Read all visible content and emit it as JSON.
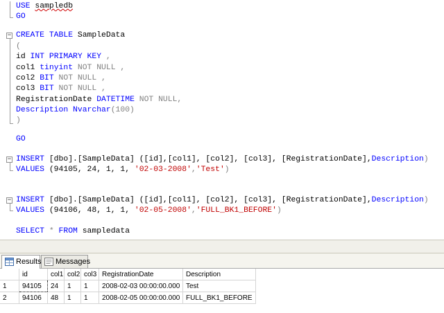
{
  "editor": {
    "lines": {
      "use_kw": "USE",
      "use_db": "sampledb",
      "go1": "GO",
      "create_kw": "CREATE TABLE",
      "create_name": " SampleData",
      "paren_open": "(",
      "id_name": "id ",
      "id_type": "INT PRIMARY KEY",
      "id_end": " ,",
      "c1_name": "col1 ",
      "c1_type": "tinyint",
      "c1_rest": " NOT NULL ,",
      "c2_name": "col2 ",
      "c2_type": "BIT",
      "c2_rest": " NOT NULL ,",
      "c3_name": "col3 ",
      "c3_type": "BIT",
      "c3_rest": " NOT NULL ,",
      "rd_name": "RegistrationDate ",
      "rd_type": "DATETIME",
      "rd_rest": " NOT NULL,",
      "de_name": "Description ",
      "de_type": "Nvarchar",
      "de_rest": "(100)",
      "paren_close": ")",
      "go2": "GO",
      "ins1_kw": "INSERT",
      "ins1_rest": " [dbo].[SampleData] ([id],[col1], [col2], [col3], [RegistrationDate],",
      "ins1_desc": "Description",
      "ins1_close": ")",
      "val1_kw": "VALUES",
      "val1_nums": " (94105, 24, 1, 1, ",
      "val1_date": "'02-03-2008'",
      "val1_comma": ",",
      "val1_str": "'Test'",
      "val1_close": ")",
      "ins2_kw": "INSERT",
      "ins2_rest": " [dbo].[SampleData] ([id],[col1], [col2], [col3], [RegistrationDate],",
      "ins2_desc": "Description",
      "ins2_close": ")",
      "val2_kw": "VALUES",
      "val2_nums": " (94106, 48, 1, 1, ",
      "val2_date": "'02-05-2008'",
      "val2_comma": ",",
      "val2_str": "'FULL_BK1_BEFORE'",
      "val2_close": ")",
      "sel_kw1": "SELECT",
      "sel_star": " * ",
      "sel_kw2": "FROM",
      "sel_table": " sampledata"
    }
  },
  "result_tabs": [
    {
      "label": "Results",
      "icon": "grid-icon"
    },
    {
      "label": "Messages",
      "icon": "messages-icon"
    }
  ],
  "results": {
    "columns": [
      "id",
      "col1",
      "col2",
      "col3",
      "RegistrationDate",
      "Description"
    ],
    "rows": [
      {
        "n": "1",
        "cells": [
          "94105",
          "24",
          "1",
          "1",
          "2008-02-03 00:00:00.000",
          "Test"
        ]
      },
      {
        "n": "2",
        "cells": [
          "94106",
          "48",
          "1",
          "1",
          "2008-02-05 00:00:00.000",
          "FULL_BK1_BEFORE"
        ]
      }
    ]
  }
}
